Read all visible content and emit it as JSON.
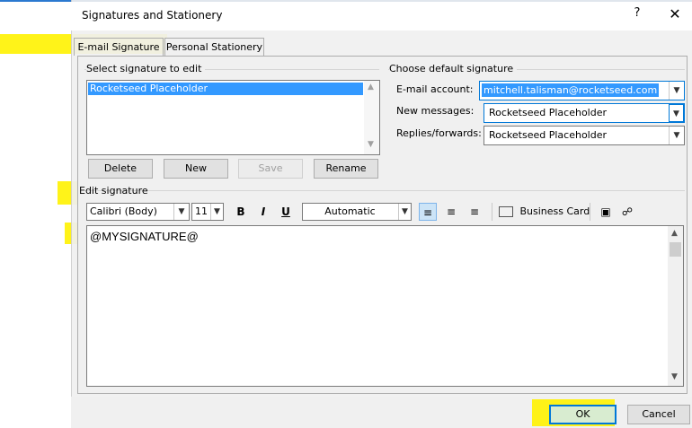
{
  "window": {
    "title": "Signatures and Stationery",
    "help_glyph": "?",
    "close_glyph": "✕"
  },
  "tabs": [
    {
      "label": "E-mail Signature",
      "active": true
    },
    {
      "label": "Personal Stationery",
      "active": false
    }
  ],
  "select_signature": {
    "group_label": "Select signature to edit",
    "items": [
      "Rocketseed Placeholder"
    ]
  },
  "signature_buttons": {
    "delete": "Delete",
    "new": "New",
    "save": "Save",
    "rename": "Rename"
  },
  "default_signature": {
    "group_label": "Choose default signature",
    "email_account_label": "E-mail account:",
    "email_account_value": "mitchell.talisman@rocketseed.com",
    "new_messages_label": "New messages:",
    "new_messages_value": "Rocketseed Placeholder",
    "replies_label": "Replies/forwards:",
    "replies_value": "Rocketseed Placeholder"
  },
  "edit_signature": {
    "label": "Edit signature",
    "font_name": "Calibri (Body)",
    "font_size": "11",
    "bold": "B",
    "italic": "I",
    "underline": "U",
    "color": "Automatic",
    "business_card": "Business Card",
    "content": "@MYSIGNATURE@"
  },
  "footer": {
    "ok": "OK",
    "cancel": "Cancel"
  },
  "colors": {
    "highlight": "#fff200",
    "selection": "#3399ff",
    "accent": "#0078d7"
  }
}
